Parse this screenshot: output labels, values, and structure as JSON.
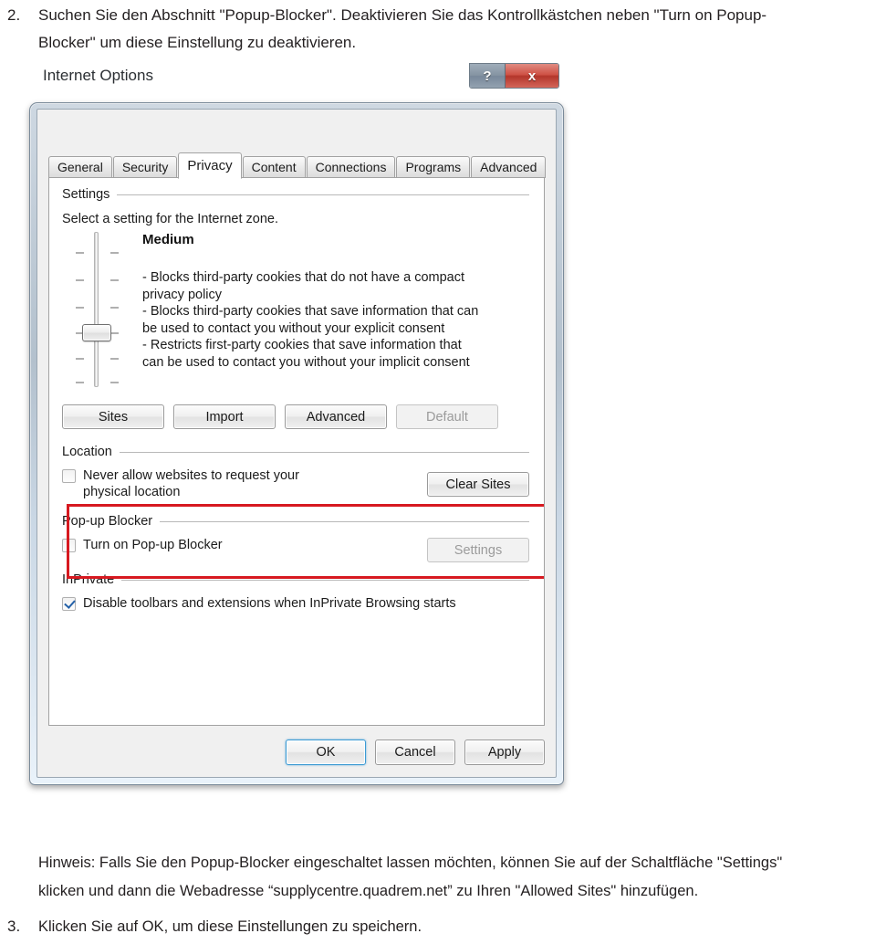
{
  "document": {
    "step2": {
      "number": "2.",
      "line1": "Suchen Sie den Abschnitt \"Popup-Blocker\".   Deaktivieren Sie das Kontrollkästchen neben \"Turn on Popup-",
      "line2": "Blocker\" um diese Einstellung zu deaktivieren."
    },
    "note": {
      "line1": "Hinweis: Falls Sie den Popup-Blocker eingeschaltet lassen möchten, können Sie auf der Schaltfläche \"Settings\"",
      "line2": "klicken und dann die Webadresse “supplycentre.quadrem.net” zu Ihren \"Allowed Sites\" hinzufügen."
    },
    "step3": {
      "number": "3.",
      "line1": "Klicken Sie auf OK, um diese Einstellungen zu speichern."
    }
  },
  "dialog": {
    "title": "Internet Options",
    "caption": {
      "help_label": "?",
      "close_label": "x"
    },
    "tabs": [
      {
        "label": "General",
        "active": false
      },
      {
        "label": "Security",
        "active": false
      },
      {
        "label": "Privacy",
        "active": true
      },
      {
        "label": "Content",
        "active": false
      },
      {
        "label": "Connections",
        "active": false
      },
      {
        "label": "Programs",
        "active": false
      },
      {
        "label": "Advanced",
        "active": false
      }
    ],
    "settings": {
      "group_label": "Settings",
      "instruction": "Select a setting for the Internet zone.",
      "zone_level": "Medium",
      "zone_description": [
        "- Blocks third-party cookies that do not have a compact",
        "privacy policy",
        "- Blocks third-party cookies that save information that can",
        "be used to contact you without your explicit consent",
        "- Restricts first-party cookies that save information that",
        "can be used to contact you without your implicit consent"
      ],
      "slider": {
        "tick_count": 6,
        "thumb_position_index": 4
      },
      "buttons": [
        {
          "label": "Sites",
          "disabled": false
        },
        {
          "label": "Import",
          "disabled": false
        },
        {
          "label": "Advanced",
          "disabled": false
        },
        {
          "label": "Default",
          "disabled": true
        }
      ]
    },
    "location": {
      "group_label": "Location",
      "checkbox_label_line1": "Never allow websites to request your",
      "checkbox_label_line2": "physical location",
      "checkbox_checked": false,
      "clear_button_label": "Clear Sites"
    },
    "popup_blocker": {
      "group_label": "Pop-up Blocker",
      "checkbox_label": "Turn on Pop-up Blocker",
      "checkbox_checked": false,
      "settings_button_label": "Settings",
      "settings_button_disabled": true,
      "highlight_color": "#d71920"
    },
    "inprivate": {
      "group_label": "InPrivate",
      "checkbox_label": "Disable toolbars and extensions when InPrivate Browsing starts",
      "checkbox_checked": true
    },
    "footer": {
      "ok_label": "OK",
      "cancel_label": "Cancel",
      "apply_label": "Apply"
    }
  }
}
